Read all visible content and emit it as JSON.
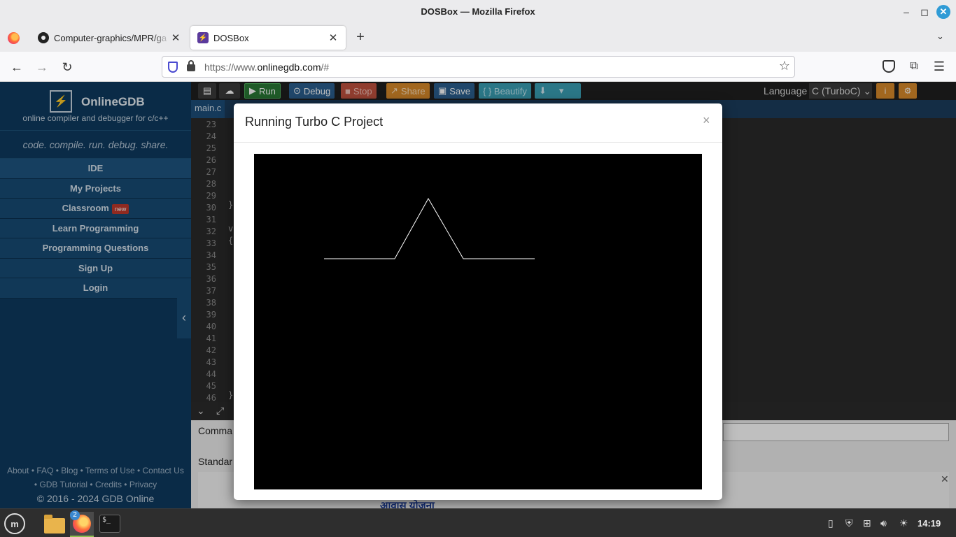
{
  "window": {
    "title": "DOSBox — Mozilla Firefox",
    "tabs": [
      {
        "label": "Computer-graphics/MPR/ga",
        "icon": "github-icon"
      },
      {
        "label": "DOSBox",
        "icon": "dosbox-icon"
      }
    ],
    "url_prefix": "https://www.",
    "url_domain": "onlinegdb.com",
    "url_suffix": "/#"
  },
  "sidebar": {
    "brand": "OnlineGDB",
    "subtitle": "online compiler and debugger for c/c++",
    "tagline": "code. compile. run. debug. share.",
    "items": [
      {
        "label": "IDE"
      },
      {
        "label": "My Projects"
      },
      {
        "label": "Classroom",
        "badge": "new"
      },
      {
        "label": "Learn Programming"
      },
      {
        "label": "Programming Questions"
      },
      {
        "label": "Sign Up"
      },
      {
        "label": "Login"
      }
    ],
    "footer_line1": "About • FAQ • Blog • Terms of Use • Contact Us",
    "footer_line2": "• GDB Tutorial • Credits • Privacy",
    "copyright": "© 2016 - 2024 GDB Online"
  },
  "toolbar": {
    "run": "Run",
    "debug": "Debug",
    "stop": "Stop",
    "share": "Share",
    "save": "Save",
    "beautify": "{ } Beautify",
    "language_label": "Language",
    "language_value": "C (TurboC)"
  },
  "editor": {
    "file_tab": "main.c",
    "line_numbers": [
      "23",
      "24",
      "25",
      "26",
      "27",
      "28",
      "29",
      "30",
      "31",
      "32",
      "33",
      "34",
      "35",
      "36",
      "37",
      "38",
      "39",
      "40",
      "41",
      "42",
      "43",
      "44",
      "45",
      "46"
    ]
  },
  "console": {
    "command_label": "Comma",
    "stdin_label": "Standar",
    "ad_text": "आवास योजना"
  },
  "modal": {
    "title": "Running Turbo C Project",
    "close": "×"
  },
  "taskbar": {
    "badge_count": "2",
    "clock": "14:19"
  }
}
